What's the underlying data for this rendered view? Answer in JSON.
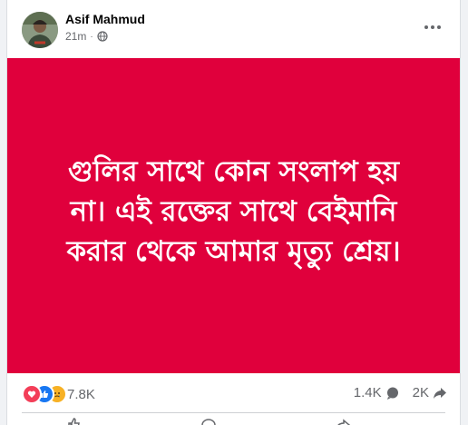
{
  "post": {
    "author": "Asif Mahmud",
    "time": "21m",
    "privacy_icon": "globe-icon",
    "banner_color": "#e0003c",
    "banner_lines": [
      "গুলির সাথে কোন সংলাপ হয়",
      "না। এই রক্তের সাথে বেইমানি",
      "করার থেকে আমার মৃত্যু শ্রেয়।"
    ],
    "reactions": {
      "icons": [
        "love-icon",
        "like-icon",
        "sad-icon"
      ],
      "count": "7.8K"
    },
    "comments_count": "1.4K",
    "shares_count": "2K"
  }
}
